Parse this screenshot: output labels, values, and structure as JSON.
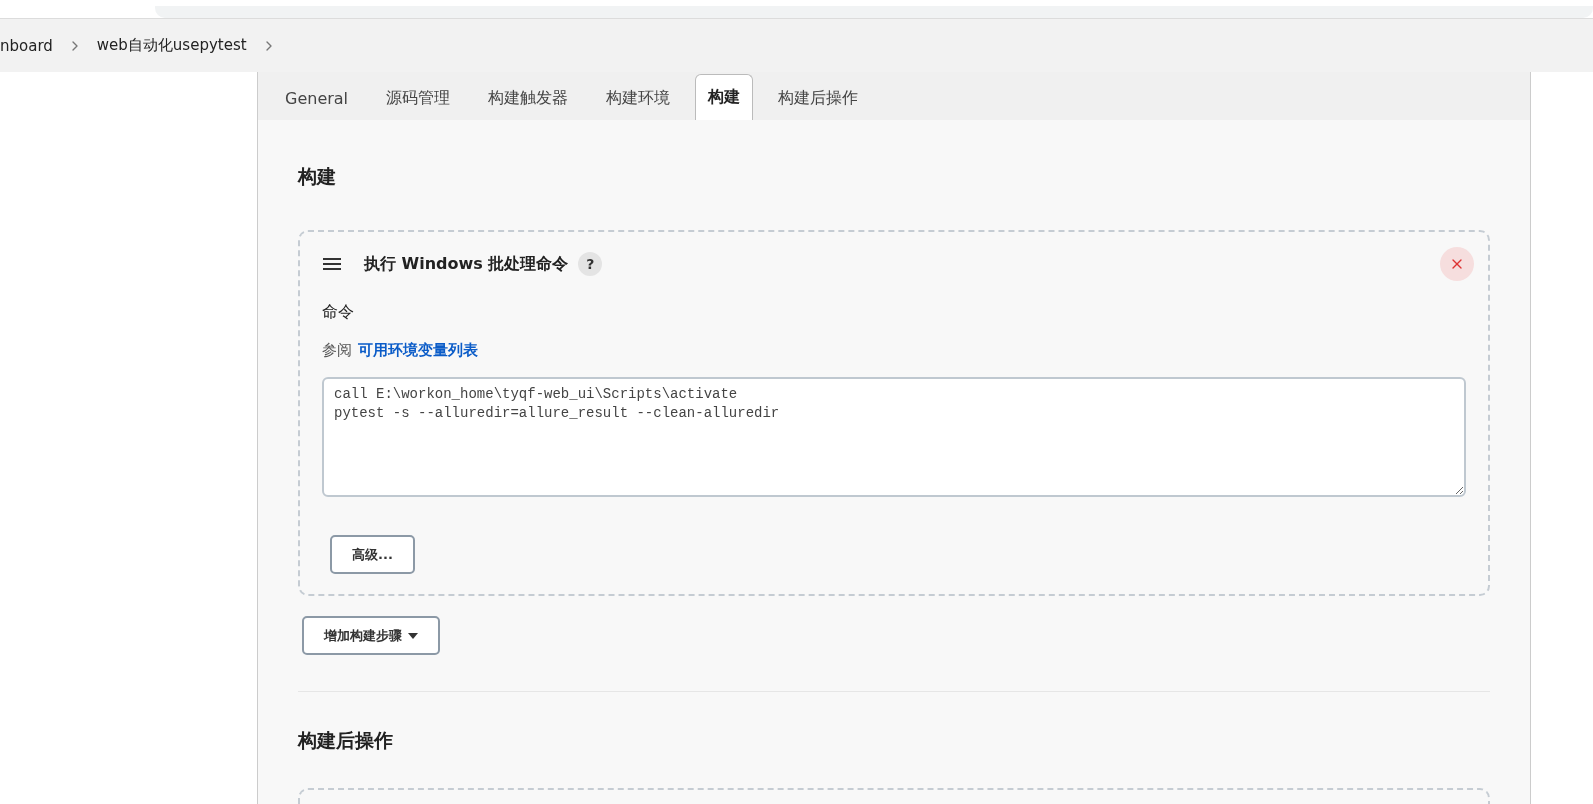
{
  "breadcrumbs": [
    {
      "label": "nboard"
    },
    {
      "label": "web自动化usepytest"
    }
  ],
  "tabs": [
    {
      "label": "General",
      "selected": false
    },
    {
      "label": "源码管理",
      "selected": false
    },
    {
      "label": "构建触发器",
      "selected": false
    },
    {
      "label": "构建环境",
      "selected": false
    },
    {
      "label": "构建",
      "selected": true
    },
    {
      "label": "构建后操作",
      "selected": false
    }
  ],
  "section_title": "构建",
  "build_step": {
    "title": "执行 Windows 批处理命令",
    "help": "?",
    "field_label": "命令",
    "see_prefix": "参阅",
    "see_link": "可用环境变量列表",
    "command": "call E:\\workon_home\\tyqf-web_ui\\Scripts\\activate\npytest -s --alluredir=allure_result --clean-alluredir",
    "advanced_button": "高级..."
  },
  "add_step_button": "增加构建步骤",
  "next_section_title": "构建后操作"
}
